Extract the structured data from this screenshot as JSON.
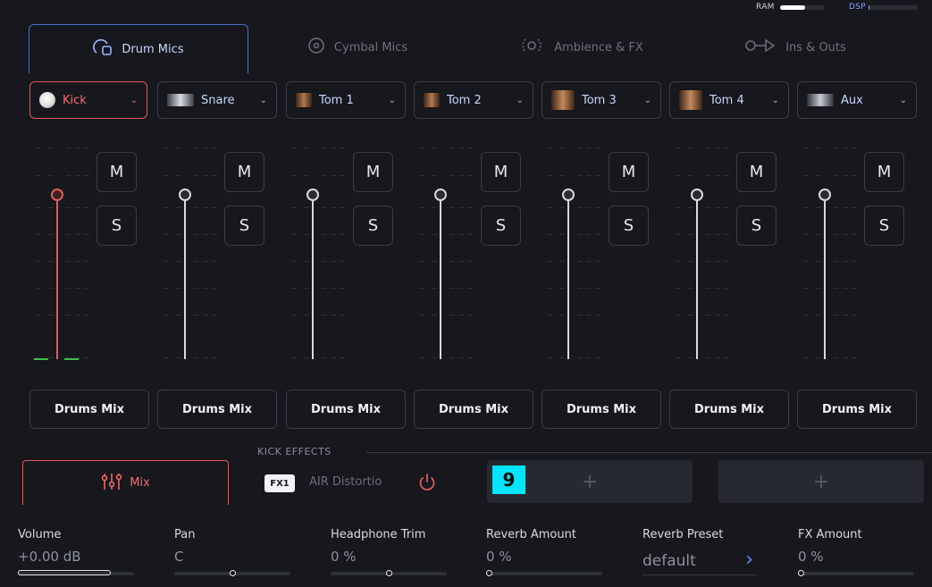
{
  "meters": {
    "ram_label": "RAM",
    "ram_fraction": 0.55,
    "dsp_label": "DSP",
    "dsp_fraction": 0.02
  },
  "tabs": [
    {
      "label": "Drum Mics",
      "icon": "drum-mics-icon",
      "active": true
    },
    {
      "label": "Cymbal Mics",
      "icon": "cymbal-icon"
    },
    {
      "label": "Ambience & FX",
      "icon": "ambience-icon"
    },
    {
      "label": "Ins & Outs",
      "icon": "ins-outs-icon"
    }
  ],
  "channels": [
    {
      "label": "Kick",
      "active": true
    },
    {
      "label": "Snare"
    },
    {
      "label": "Tom 1"
    },
    {
      "label": "Tom 2"
    },
    {
      "label": "Tom 3"
    },
    {
      "label": "Tom 4"
    },
    {
      "label": "Aux"
    }
  ],
  "mixer": {
    "mute_label": "M",
    "solo_label": "S",
    "output_label": "Drums Mix"
  },
  "effects": {
    "header": "KICK EFFECTS",
    "mix_label": "Mix",
    "fx_badge": "FX1",
    "fx_name": "AIR Distortio",
    "slot_add": "+",
    "slot_number": "9"
  },
  "params": [
    {
      "label": "Volume",
      "value": "+0.00 dB",
      "level": 0.8
    },
    {
      "label": "Pan",
      "value": "C",
      "level": 0.5
    },
    {
      "label": "Headphone Trim",
      "value": "0 %",
      "level": 0.5
    },
    {
      "label": "Reverb Amount",
      "value": "0 %",
      "level": 0.0
    },
    {
      "label": "Reverb Preset",
      "value": "default"
    },
    {
      "label": "FX Amount",
      "value": "0 %",
      "level": 0.0
    }
  ],
  "colors": {
    "accent": "#e35a5a",
    "tab_active": "#4c6fd8",
    "background": "#16181d"
  }
}
